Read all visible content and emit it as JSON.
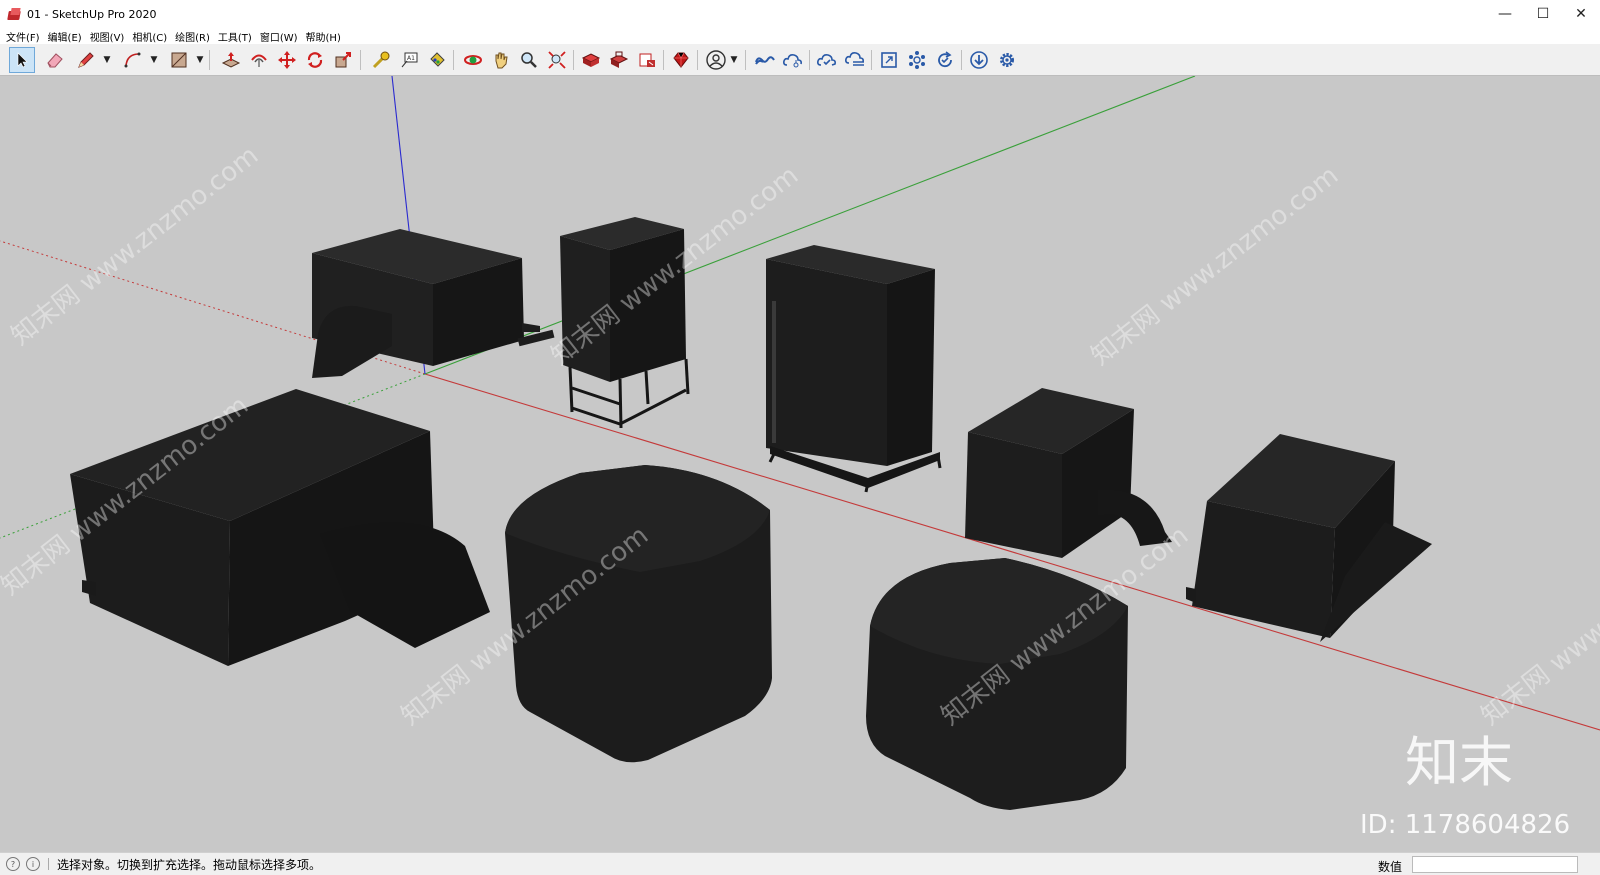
{
  "window": {
    "title": "01 - SketchUp Pro 2020",
    "controls": {
      "minimize": "—",
      "maximize": "☐",
      "close": "✕"
    }
  },
  "menu": [
    "文件(F)",
    "编辑(E)",
    "视图(V)",
    "相机(C)",
    "绘图(R)",
    "工具(T)",
    "窗口(W)",
    "帮助(H)"
  ],
  "toolbar": {
    "tools": [
      {
        "name": "select-tool",
        "icon": "arrow-cursor-icon",
        "selected": true
      },
      {
        "name": "eraser-tool",
        "icon": "eraser-icon"
      },
      {
        "name": "line-tool",
        "icon": "pencil-icon"
      },
      {
        "name": "arc-tool",
        "icon": "arc-icon"
      },
      {
        "name": "rectangle-tool",
        "icon": "rectangle-icon"
      },
      {
        "name": "push-pull-tool",
        "icon": "push-pull-icon"
      },
      {
        "name": "offset-tool",
        "icon": "offset-icon"
      },
      {
        "name": "move-tool",
        "icon": "move-icon"
      },
      {
        "name": "rotate-tool",
        "icon": "rotate-icon"
      },
      {
        "name": "scale-tool",
        "icon": "scale-icon"
      },
      {
        "name": "tape-measure-tool",
        "icon": "tape-measure-icon"
      },
      {
        "name": "text-tool",
        "icon": "text-icon"
      },
      {
        "name": "paint-bucket-tool",
        "icon": "paint-bucket-icon"
      },
      {
        "name": "orbit-tool",
        "icon": "orbit-icon"
      },
      {
        "name": "pan-tool",
        "icon": "hand-icon"
      },
      {
        "name": "zoom-tool",
        "icon": "zoom-icon"
      },
      {
        "name": "zoom-extents-tool",
        "icon": "zoom-extents-icon"
      },
      {
        "name": "warehouse-tool",
        "icon": "3d-warehouse-icon"
      },
      {
        "name": "extension-warehouse-tool",
        "icon": "extension-warehouse-icon"
      },
      {
        "name": "layout-tool",
        "icon": "layout-icon"
      },
      {
        "name": "extension-manager-tool",
        "icon": "ruby-gem-icon"
      },
      {
        "name": "account-tool",
        "icon": "user-account-icon"
      },
      {
        "name": "trimble-connect-tool",
        "icon": "trimble-connect-icon"
      },
      {
        "name": "share-tool",
        "icon": "cloud-share-icon"
      },
      {
        "name": "cloud-sync-tool",
        "icon": "cloud-check-icon"
      },
      {
        "name": "cloud-list-tool",
        "icon": "cloud-list-icon"
      },
      {
        "name": "fit-view-tool",
        "icon": "fit-view-icon"
      },
      {
        "name": "components-tool",
        "icon": "components-icon"
      },
      {
        "name": "refresh-tool",
        "icon": "refresh-check-icon"
      },
      {
        "name": "import-tool",
        "icon": "download-icon"
      },
      {
        "name": "settings-tool",
        "icon": "gear-icon"
      }
    ]
  },
  "viewport": {
    "background": "#c8c8c8",
    "axis_colors": {
      "red": "#c43a3a",
      "green": "#3aa03a",
      "blue": "#2a2ad0"
    },
    "model_color": "#1c1c1c",
    "watermark": "知末网 www.znzmo.com",
    "brand_logo": "知末",
    "id_label": "ID: 1178604826"
  },
  "status": {
    "message": "选择对象。切换到扩充选择。拖动鼠标选择多项。",
    "measure_label": "数值",
    "measure_value": ""
  }
}
